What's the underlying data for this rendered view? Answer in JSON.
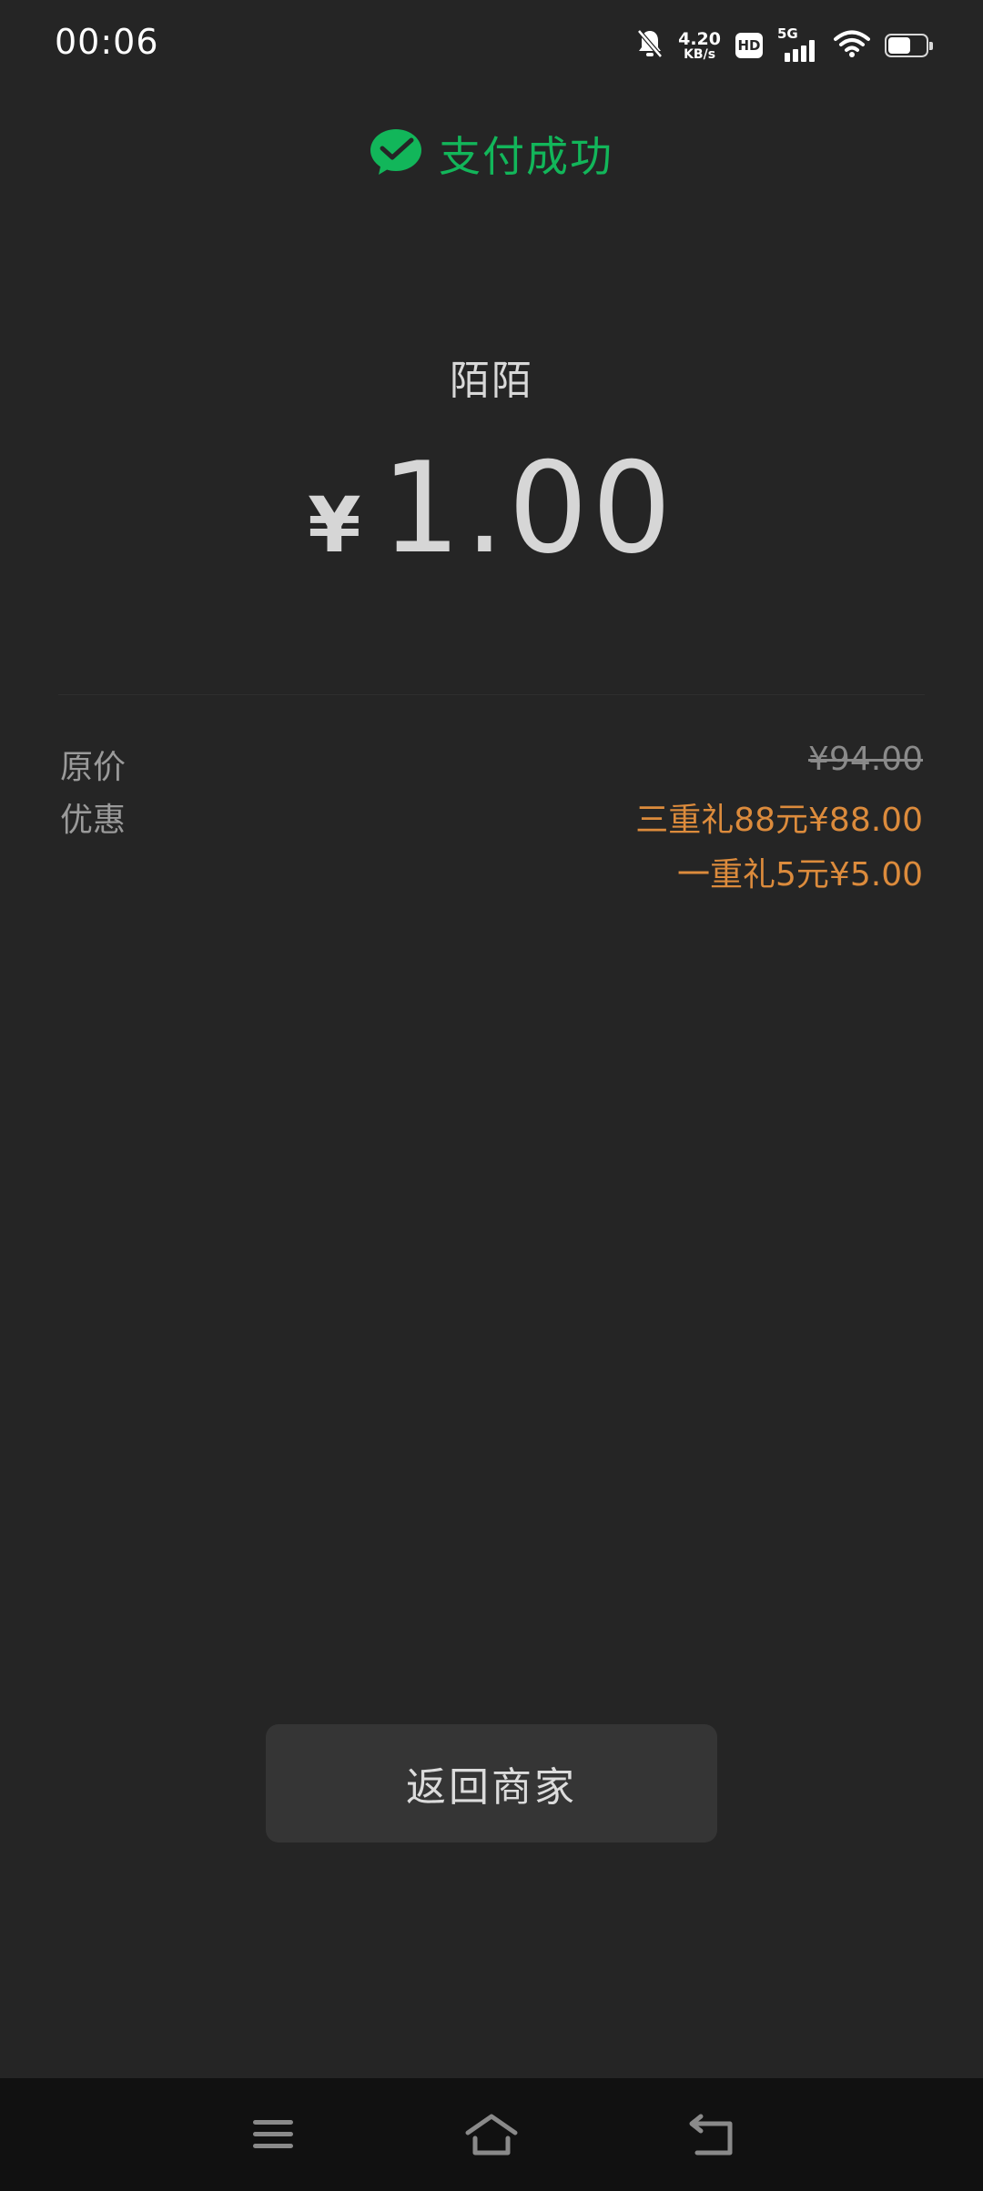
{
  "status_bar": {
    "time": "00:06",
    "net_speed_value": "4.20",
    "net_speed_unit": "KB/s",
    "hd": "HD",
    "network": "5G",
    "battery_level_percent": 60,
    "icons": [
      "mute-bell-icon",
      "hd-icon",
      "signal-icon",
      "wifi-icon",
      "battery-icon"
    ]
  },
  "header": {
    "icon": "wechat-pay-icon",
    "title": "支付成功",
    "accent_color": "#12b65a"
  },
  "payment": {
    "merchant": "陌陌",
    "currency_symbol": "¥",
    "amount": "1.00"
  },
  "details": {
    "original_label": "原价",
    "original_value": "¥94.00",
    "discount_label": "优惠",
    "discounts": [
      "三重礼88元¥88.00",
      "一重礼5元¥5.00"
    ],
    "discount_color": "#dc8b3c"
  },
  "actions": {
    "return_label": "返回商家"
  },
  "nav_bar": {
    "icons": [
      "menu-icon",
      "home-icon",
      "back-icon"
    ]
  }
}
